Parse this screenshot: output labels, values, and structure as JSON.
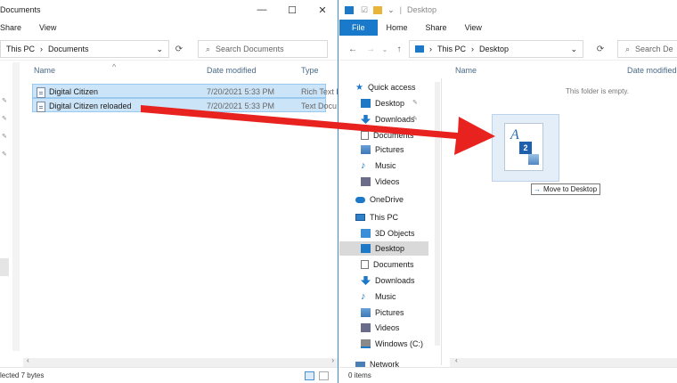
{
  "left": {
    "title": "Documents",
    "ribbon_tabs": [
      "Share",
      "View"
    ],
    "address_root": "This PC",
    "address_folder": "Documents",
    "search_placeholder": "Search Documents",
    "columns": {
      "name": "Name",
      "date": "Date modified",
      "type": "Type"
    },
    "files": [
      {
        "name": "Digital Citizen",
        "date": "7/20/2021 5:33 PM",
        "type": "Rich Text D"
      },
      {
        "name": "Digital Citizen reloaded",
        "date": "7/20/2021 5:33 PM",
        "type": "Text Docu"
      }
    ],
    "status": "lected  7 bytes"
  },
  "right": {
    "title": "Desktop",
    "ribbon_tabs": [
      "File",
      "Home",
      "Share",
      "View"
    ],
    "address_root": "This PC",
    "address_folder": "Desktop",
    "search_placeholder": "Search De",
    "columns": {
      "name": "Name",
      "date": "Date modified"
    },
    "empty_text": "This folder is empty.",
    "nav": {
      "quick_access": "Quick access",
      "qa_items": [
        "Desktop",
        "Downloads",
        "Documents",
        "Pictures",
        "Music",
        "Videos"
      ],
      "onedrive": "OneDrive",
      "this_pc": "This PC",
      "pc_items": [
        "3D Objects",
        "Desktop",
        "Documents",
        "Downloads",
        "Music",
        "Pictures",
        "Videos",
        "Windows (C:)"
      ],
      "network": "Network"
    },
    "status": "0 items"
  },
  "drag": {
    "badge": "2",
    "tooltip": "Move to Desktop"
  },
  "colors": {
    "arrow": "#e8231f",
    "selection": "#cce4f7",
    "accent": "#1979ca"
  }
}
